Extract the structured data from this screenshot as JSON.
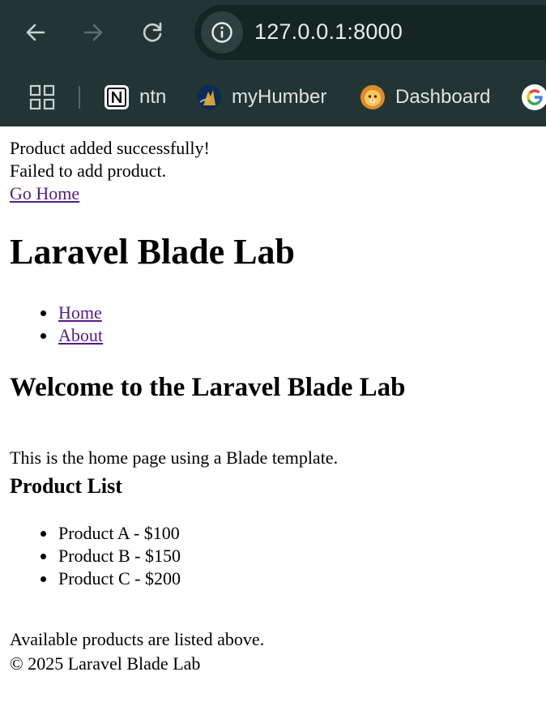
{
  "browser": {
    "url": "127.0.0.1:8000",
    "colors": {
      "chrome_bg": "#223534",
      "omnibox_bg": "#142523",
      "icon": "#c9d1d0",
      "icon_disabled": "#5e6e6d"
    },
    "bookmarks": [
      {
        "label": "ntn",
        "icon": "notion-icon"
      },
      {
        "label": "myHumber",
        "icon": "humber-icon"
      },
      {
        "label": "Dashboard",
        "icon": "lion-icon"
      },
      {
        "label": "",
        "icon": "google-icon"
      }
    ]
  },
  "page": {
    "flash_success": "Product added successfully!",
    "flash_error": "Failed to add product.",
    "go_home_link": "Go Home",
    "site_title": "Laravel Blade Lab",
    "nav": [
      {
        "label": "Home"
      },
      {
        "label": "About"
      }
    ],
    "welcome_heading": "Welcome to the Laravel Blade Lab",
    "intro_text": "This is the home page using a Blade template.",
    "products_heading": "Product List",
    "products": [
      {
        "label": "Product A - $100"
      },
      {
        "label": "Product B - $150"
      },
      {
        "label": "Product C - $200"
      }
    ],
    "available_text": "Available products are listed above.",
    "footer": "© 2025 Laravel Blade Lab",
    "colors": {
      "visited_link": "#551a8b"
    }
  }
}
